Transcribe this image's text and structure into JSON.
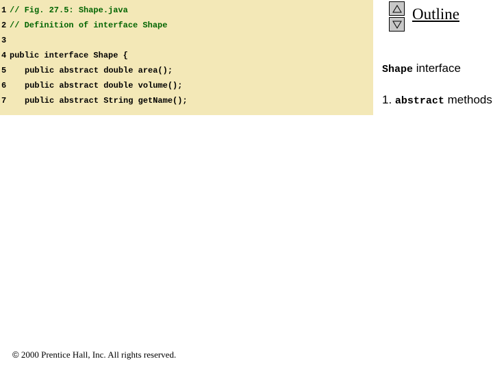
{
  "outline": {
    "title": "Outline"
  },
  "nav": {
    "up_label": "up",
    "down_label": "down"
  },
  "code": {
    "lines": [
      {
        "n": "1",
        "text": "// Fig. 27.5: Shape.java",
        "cls": "comment"
      },
      {
        "n": "2",
        "text": "// Definition of interface Shape",
        "cls": "comment"
      },
      {
        "n": "3",
        "text": "",
        "cls": "code-text"
      },
      {
        "n": "4",
        "text": "public interface Shape {",
        "cls": "code-text"
      },
      {
        "n": "5",
        "text": "public abstract double area();",
        "cls": "code-text",
        "indent": true
      },
      {
        "n": "6",
        "text": "public abstract double volume();",
        "cls": "code-text",
        "indent": true
      },
      {
        "n": "7",
        "text": "public abstract String getName();",
        "cls": "code-text",
        "indent": true
      }
    ]
  },
  "notes": {
    "n1_mono": "Shape",
    "n1_rest": " interface",
    "n2_prefix": "1. ",
    "n2_mono": "abstract",
    "n2_rest": " methods"
  },
  "footer": {
    "copyright_symbol": "©",
    "text": " 2000 Prentice Hall, Inc. All rights reserved."
  }
}
